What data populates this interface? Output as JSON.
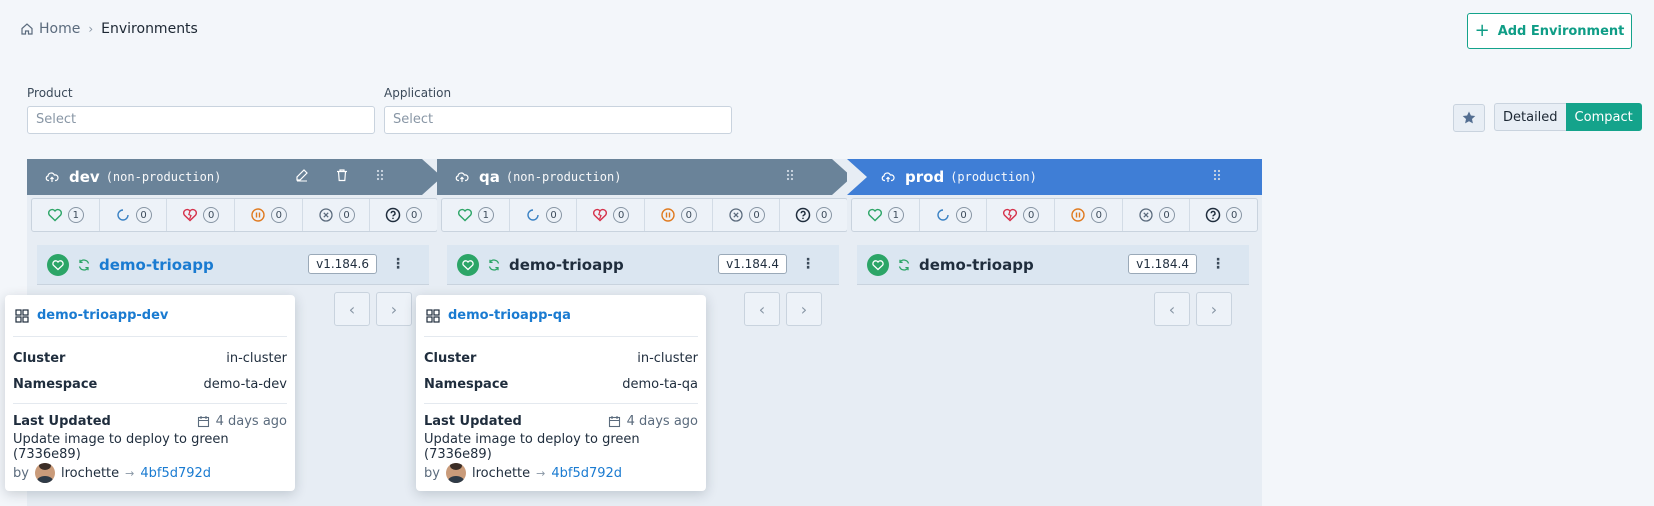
{
  "breadcrumb": {
    "home": "Home",
    "current": "Environments"
  },
  "actions": {
    "add_environment": "Add Environment"
  },
  "filters": {
    "product": {
      "label": "Product",
      "placeholder": "Select"
    },
    "application": {
      "label": "Application",
      "placeholder": "Select"
    }
  },
  "view_toggle": {
    "detailed": "Detailed",
    "compact": "Compact",
    "selected": "Compact"
  },
  "colors": {
    "accent": "#14a38b",
    "link": "#1a7bd1",
    "nonprod_header": "#6a8399",
    "prod_header": "#3f7ed6",
    "healthy": "#2ca567",
    "progressing": "#3b82c4",
    "degraded": "#d6314a",
    "suspended": "#e07b21"
  },
  "status_icons": [
    "heart-icon",
    "progressing-icon",
    "broken-heart-icon",
    "pause-icon",
    "x-circle-icon",
    "question-icon"
  ],
  "environments": [
    {
      "name": "dev",
      "type": "(non-production)",
      "counts": [
        "1",
        "0",
        "0",
        "0",
        "0",
        "0"
      ],
      "app": {
        "name": "demo-trioapp",
        "version": "v1.184.6"
      }
    },
    {
      "name": "qa",
      "type": "(non-production)",
      "counts": [
        "1",
        "0",
        "0",
        "0",
        "0",
        "0"
      ],
      "app": {
        "name": "demo-trioapp",
        "version": "v1.184.4"
      }
    },
    {
      "name": "prod",
      "type": "(production)",
      "counts": [
        "1",
        "0",
        "0",
        "0",
        "0",
        "0"
      ],
      "app": {
        "name": "demo-trioapp",
        "version": "v1.184.4"
      }
    }
  ],
  "popovers": [
    {
      "title": "demo-trioapp-dev",
      "cluster_label": "Cluster",
      "cluster": "in-cluster",
      "namespace_label": "Namespace",
      "namespace": "demo-ta-dev",
      "updated_label": "Last Updated",
      "updated": "4 days ago",
      "message": "Update image to deploy to green (7336e89)",
      "by": "by",
      "author": "lrochette",
      "sha": "4bf5d792d"
    },
    {
      "title": "demo-trioapp-qa",
      "cluster_label": "Cluster",
      "cluster": "in-cluster",
      "namespace_label": "Namespace",
      "namespace": "demo-ta-qa",
      "updated_label": "Last Updated",
      "updated": "4 days ago",
      "message": "Update image to deploy to green (7336e89)",
      "by": "by",
      "author": "lrochette",
      "sha": "4bf5d792d"
    }
  ]
}
